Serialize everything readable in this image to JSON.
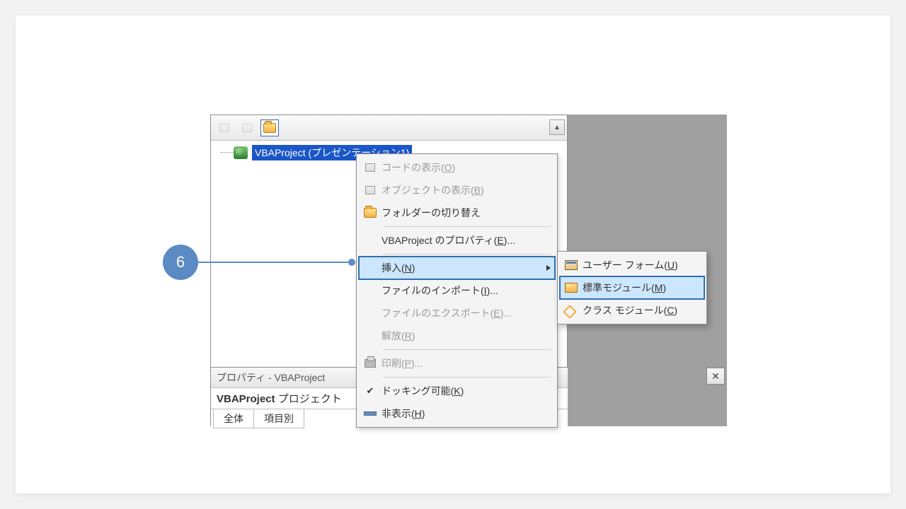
{
  "callout": {
    "number": "6"
  },
  "explorer": {
    "project_label": "VBAProject (プレゼンテーション1)"
  },
  "properties": {
    "title": "プロパティ - VBAProject",
    "name_bold": "VBAProject",
    "name_rest": " プロジェクト",
    "tab_all": "全体",
    "tab_cat": "項目別"
  },
  "context_menu": {
    "view_code": {
      "label": "コードの表示(",
      "mn": "O",
      "after": ")"
    },
    "view_object": {
      "label": "オブジェクトの表示(",
      "mn": "B",
      "after": ")"
    },
    "toggle_folders": {
      "label": "フォルダーの切り替え"
    },
    "properties": {
      "label": "VBAProject のプロパティ(",
      "mn": "E",
      "after": ")..."
    },
    "insert": {
      "label": "挿入(",
      "mn": "N",
      "after": ")"
    },
    "import": {
      "label": "ファイルのインポート(",
      "mn": "I",
      "after": ")..."
    },
    "export": {
      "label": "ファイルのエクスポート(",
      "mn": "E",
      "after": ")..."
    },
    "remove": {
      "label": "解放(",
      "mn": "R",
      "after": ")"
    },
    "print": {
      "label": "印刷(",
      "mn": "P",
      "after": ")..."
    },
    "dockable": {
      "label": "ドッキング可能(",
      "mn": "K",
      "after": ")"
    },
    "hide": {
      "label": "非表示(",
      "mn": "H",
      "after": ")"
    }
  },
  "submenu": {
    "userform": {
      "label": "ユーザー フォーム(",
      "mn": "U",
      "after": ")"
    },
    "module": {
      "label": "標準モジュール(",
      "mn": "M",
      "after": ")"
    },
    "classmod": {
      "label": "クラス モジュール(",
      "mn": "C",
      "after": ")"
    }
  }
}
